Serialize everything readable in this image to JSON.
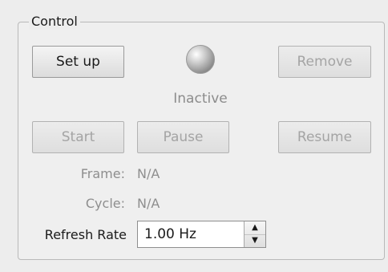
{
  "group": {
    "title": "Control"
  },
  "buttons": {
    "setup": "Set up",
    "remove": "Remove",
    "start": "Start",
    "pause": "Pause",
    "resume": "Resume"
  },
  "status": {
    "text": "Inactive"
  },
  "info": {
    "frame_label": "Frame:",
    "frame_value": "N/A",
    "cycle_label": "Cycle:",
    "cycle_value": "N/A"
  },
  "refresh": {
    "label": "Refresh Rate",
    "value": "1.00 Hz",
    "up_icon": "arrow-up-icon",
    "down_icon": "arrow-down-icon"
  }
}
